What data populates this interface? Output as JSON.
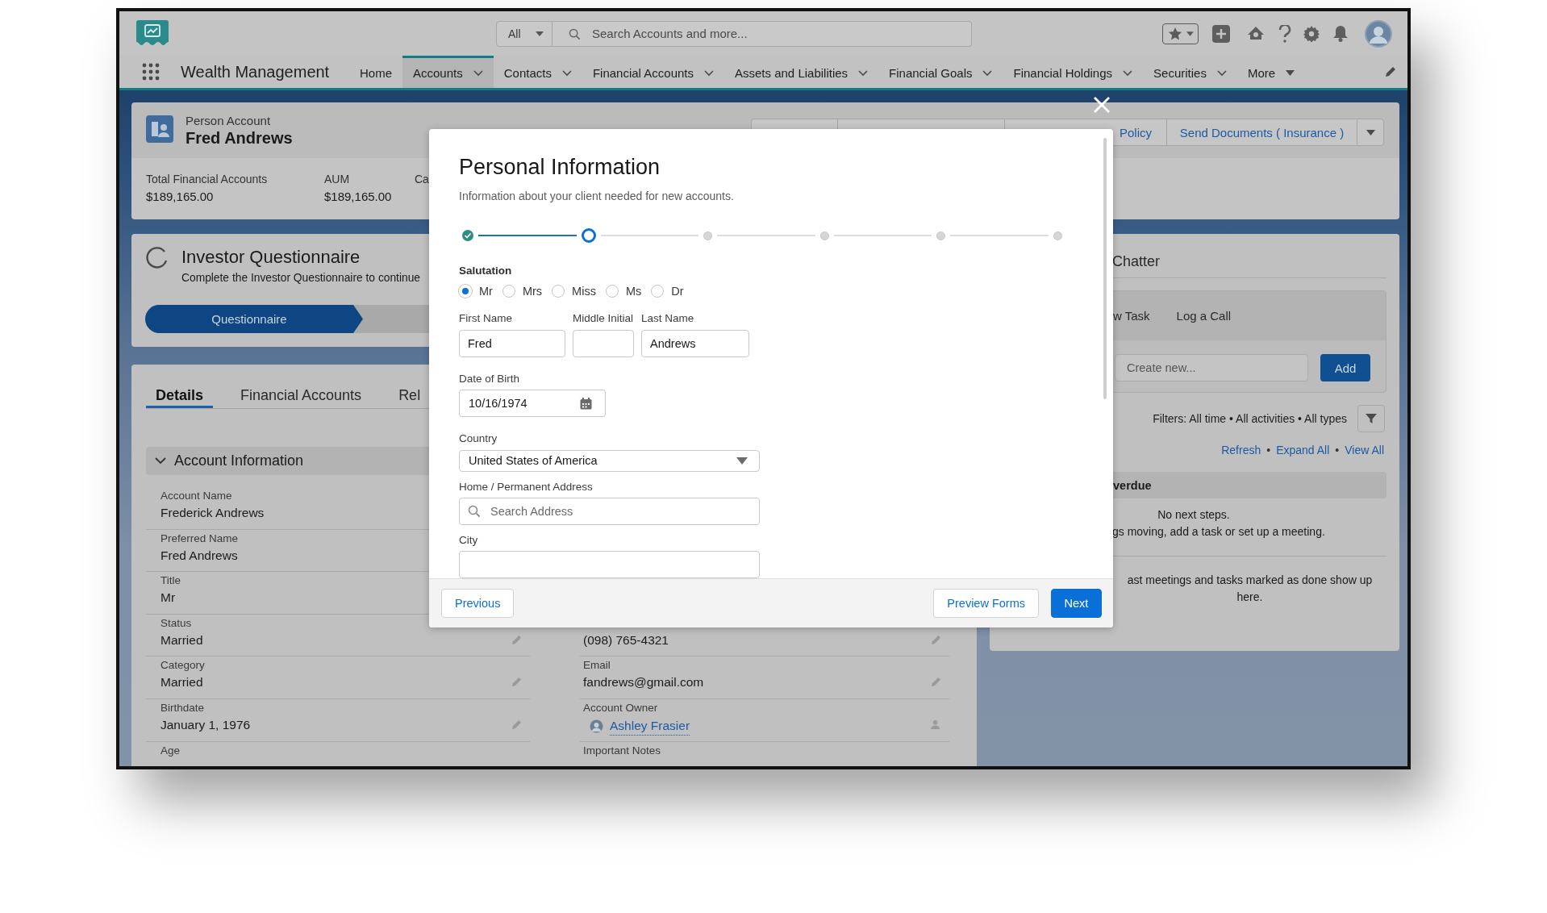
{
  "header": {
    "search_scope": "All",
    "search_placeholder": "Search Accounts and more...",
    "app_name": "Wealth Management"
  },
  "nav_tabs": [
    {
      "label": "Home",
      "selected": false
    },
    {
      "label": "Accounts",
      "selected": true,
      "kind": "chevron"
    },
    {
      "label": "Contacts",
      "selected": false,
      "kind": "chevron"
    },
    {
      "label": "Financial Accounts",
      "selected": false,
      "kind": "chevron"
    },
    {
      "label": "Assets and Liabilities",
      "selected": false,
      "kind": "chevron"
    },
    {
      "label": "Financial Goals",
      "selected": false,
      "kind": "chevron"
    },
    {
      "label": "Financial Holdings",
      "selected": false,
      "kind": "chevron"
    },
    {
      "label": "Securities",
      "selected": false,
      "kind": "chevron"
    },
    {
      "label": "More",
      "selected": false,
      "kind": "caret"
    }
  ],
  "record": {
    "type": "Person Account",
    "name": "Fred Andrews",
    "actions": [
      {
        "label": "Policy"
      },
      {
        "label": "Send Documents ( Insurance )"
      }
    ]
  },
  "highlights": [
    {
      "label": "Total Financial Accounts",
      "value": "$189,165.00"
    },
    {
      "label": "AUM",
      "value": "$189,165.00"
    },
    {
      "label": "Ca"
    }
  ],
  "questionnaire": {
    "title": "Investor Questionnaire",
    "text": "Complete the Investor Questionnaire to continue",
    "stage": "Questionnaire"
  },
  "detail_tabs": [
    {
      "label": "Details",
      "selected": true
    },
    {
      "label": "Financial Accounts",
      "selected": false
    },
    {
      "label": "Rel",
      "selected": false
    }
  ],
  "section": {
    "title": "Account Information",
    "expanded": true
  },
  "fields_left": [
    {
      "label": "Account Name",
      "value": "Frederick Andrews",
      "editable": false
    },
    {
      "label": "Preferred Name",
      "value": "Fred Andrews",
      "editable": false
    },
    {
      "label": "Title",
      "value": "Mr",
      "editable": false
    },
    {
      "label": "Status",
      "value": "Married",
      "editable": true
    },
    {
      "label": "Category",
      "value": "Married",
      "editable": true
    },
    {
      "label": "Birthdate",
      "value": "January 1, 1976",
      "editable": true
    },
    {
      "label": "Age",
      "editable": false
    }
  ],
  "fields_right": [
    {
      "value": "(098) 765-4321",
      "editable": true
    },
    {
      "label": "Email",
      "value": "fandrews@gmail.com",
      "editable": true
    },
    {
      "label": "Account Owner",
      "value": "Ashley Frasier",
      "kind": "user",
      "editable": true
    },
    {
      "label": "Important Notes",
      "editable": false
    }
  ],
  "activity": {
    "tab": "Chatter",
    "composer_tabs": [
      "w Task",
      "Log a Call"
    ],
    "composer_placeholder": "Create new...",
    "add_button": "Add",
    "filters": "Filters: All time • All activities • All types",
    "links": [
      {
        "label": "Refresh"
      },
      {
        "label": "Expand All"
      },
      {
        "label": "View All"
      }
    ],
    "separators": [
      "•",
      "•"
    ],
    "overdue": "verdue",
    "empty_title": "No next steps.",
    "empty_text": "gs moving, add a task or set up a meeting.",
    "past_text": "ast meetings and tasks marked as done show up here."
  },
  "modal": {
    "title": "Personal Information",
    "subtitle": "Information about your client needed for new accounts.",
    "steps": [
      {
        "kind": "complete"
      },
      {
        "kind": "current"
      },
      {
        "kind": "upcoming"
      },
      {
        "kind": "upcoming"
      },
      {
        "kind": "upcoming"
      },
      {
        "kind": "upcoming"
      }
    ],
    "salutation": {
      "label": "Salutation",
      "options": [
        {
          "label": "Mr",
          "selected": true
        },
        {
          "label": "Mrs",
          "selected": false
        },
        {
          "label": "Miss",
          "selected": false
        },
        {
          "label": "Ms",
          "selected": false
        },
        {
          "label": "Dr",
          "selected": false
        }
      ]
    },
    "name_fields": [
      {
        "label": "First Name",
        "value": "Fred"
      },
      {
        "label": "Middle Initial"
      },
      {
        "label": "Last Name",
        "value": "Andrews"
      }
    ],
    "birth_date": {
      "label": "Date of Birth",
      "value": "10/16/1974"
    },
    "country": {
      "label": "Country",
      "value": "United States of America"
    },
    "address": {
      "label": "Home / Permanent Address",
      "placeholder": "Search Address"
    },
    "city": {
      "label": "City"
    },
    "buttons": {
      "previous": "Previous",
      "preview": "Preview Forms",
      "next": "Next"
    }
  }
}
